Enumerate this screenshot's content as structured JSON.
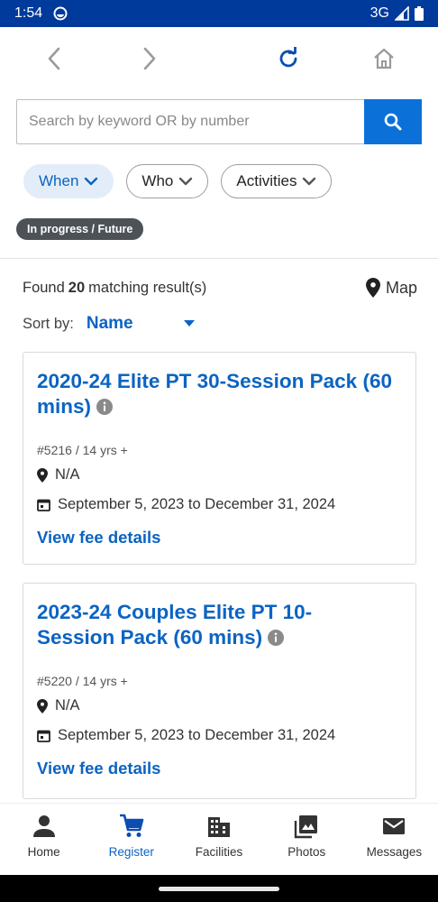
{
  "status_bar": {
    "time": "1:54",
    "network": "3G"
  },
  "search": {
    "placeholder": "Search by keyword OR by number"
  },
  "filters": [
    {
      "label": "When"
    },
    {
      "label": "Who"
    },
    {
      "label": "Activities"
    }
  ],
  "status_tag": "In progress / Future",
  "results": {
    "prefix": "Found",
    "count": "20",
    "suffix": "matching result(s)",
    "map_label": "Map"
  },
  "sort": {
    "label": "Sort by:",
    "value": "Name"
  },
  "cards": [
    {
      "title": "2020-24 Elite PT 30-Session Pack (60 mins)",
      "number": "#5216",
      "age": "14 yrs +",
      "location": "N/A",
      "dates": "September 5, 2023 to December 31, 2024",
      "link": "View fee details"
    },
    {
      "title_line1": "2023-24 Couples Elite PT 10-",
      "title_line2": "Session Pack (60 mins)",
      "number": "#5220",
      "age": "14 yrs +",
      "location": "N/A",
      "dates": "September 5, 2023 to December 31, 2024",
      "link": "View fee details"
    }
  ],
  "tabs": [
    {
      "label": "Home",
      "icon": "person-icon"
    },
    {
      "label": "Register",
      "icon": "cart-icon"
    },
    {
      "label": "Facilities",
      "icon": "building-icon"
    },
    {
      "label": "Photos",
      "icon": "photos-icon"
    },
    {
      "label": "Messages",
      "icon": "mail-icon"
    }
  ],
  "colors": {
    "status_bar": "#003a9b",
    "accent": "#0b64c2",
    "search_button": "#0b71d9",
    "tag": "#4c5258"
  }
}
